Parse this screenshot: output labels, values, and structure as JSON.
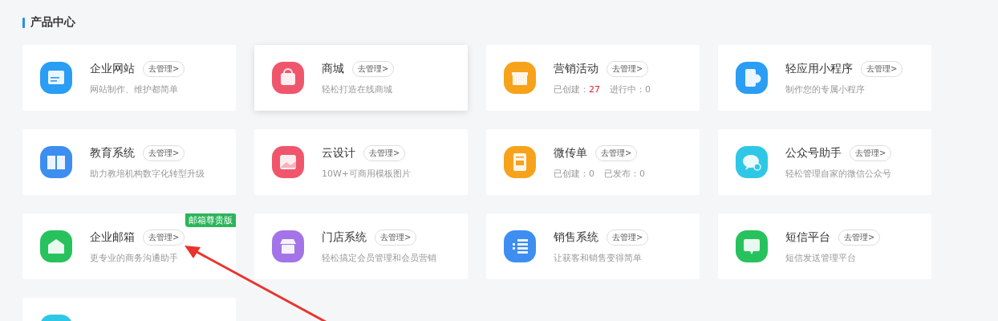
{
  "section_title": "产品中心",
  "cards": [
    {
      "title": "企业网站",
      "manage": "去管理>",
      "desc": "网站制作、维护都简单",
      "color": "#2a9df4",
      "highlighted": false
    },
    {
      "title": "商城",
      "manage": "去管理>",
      "desc": "轻松打造在线商城",
      "color": "#f0566b",
      "highlighted": true
    },
    {
      "title": "营销活动",
      "manage": "去管理>",
      "stats": [
        {
          "label": "已创建：",
          "value": "27",
          "emphasis": true
        },
        {
          "label": "进行中：",
          "value": "0",
          "emphasis": false
        }
      ],
      "color": "#f7a21b",
      "highlighted": false
    },
    {
      "title": "轻应用小程序",
      "manage": "去管理>",
      "desc": "制作您的专属小程序",
      "color": "#2a9df4",
      "highlighted": false
    },
    {
      "title": "教育系统",
      "manage": "去管理>",
      "desc": "助力教培机构数字化转型升级",
      "color": "#3d8ef0",
      "highlighted": false
    },
    {
      "title": "云设计",
      "manage": "去管理>",
      "desc": "10W+可商用模板图片",
      "color": "#f0566b",
      "highlighted": false
    },
    {
      "title": "微传单",
      "manage": "去管理>",
      "stats": [
        {
          "label": "已创建：",
          "value": "0",
          "emphasis": false
        },
        {
          "label": "已发布：",
          "value": "0",
          "emphasis": false
        }
      ],
      "color": "#f7a21b",
      "highlighted": false
    },
    {
      "title": "公众号助手",
      "manage": "去管理>",
      "desc": "轻松管理自家的微信公众号",
      "color": "#2ec8e6",
      "highlighted": false
    },
    {
      "title": "企业邮箱",
      "manage": "去管理>",
      "desc": "更专业的商务沟通助手",
      "badge": "邮箱尊贵版",
      "color": "#27c25d",
      "highlighted": false
    },
    {
      "title": "门店系统",
      "manage": "去管理>",
      "desc": "轻松搞定会员管理和会员营销",
      "color": "#a374e8",
      "highlighted": false
    },
    {
      "title": "销售系统",
      "manage": "去管理>",
      "desc": "让获客和销售变得简单",
      "color": "#3d8ef0",
      "highlighted": false
    },
    {
      "title": "短信平台",
      "manage": "去管理>",
      "desc": "短信发送管理平台",
      "color": "#27c25d",
      "highlighted": false
    },
    {
      "color": "#2ec8e6",
      "highlighted": false
    }
  ]
}
